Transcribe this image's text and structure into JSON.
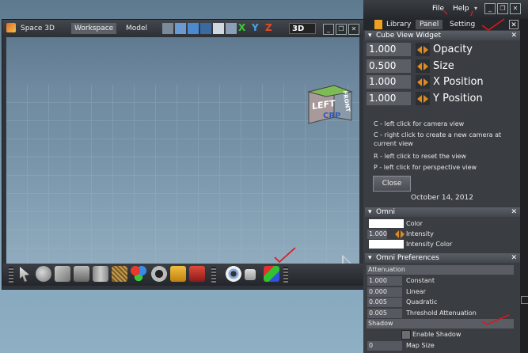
{
  "menubar": {
    "file": "File",
    "help": "Help"
  },
  "window3d": {
    "tabs": [
      "Space 3D",
      "Workspace",
      "Model"
    ],
    "axes": [
      "X",
      "Y",
      "Z"
    ],
    "mode_label": "3D",
    "cube_faces": {
      "left": "LEFT",
      "front": "FRONT"
    },
    "cube_caption": "CRP"
  },
  "panel": {
    "tabs": [
      "Library",
      "Panel",
      "Setting"
    ],
    "cube_widget": {
      "title": "Cube View Widget",
      "fields": [
        {
          "value": "1.000",
          "label": "Opacity"
        },
        {
          "value": "0.500",
          "label": "Size"
        },
        {
          "value": "1.000",
          "label": "X Position"
        },
        {
          "value": "1.000",
          "label": "Y Position"
        }
      ],
      "help": [
        "C - left click for camera view",
        "C - right click to create a new camera at",
        "current view",
        "R - left click to reset the view",
        "P - left click for perspective view"
      ],
      "close_label": "Close",
      "date": "October 14, 2012"
    },
    "omni": {
      "title": "Omni",
      "rows": [
        {
          "value": "",
          "label": "Color"
        },
        {
          "value": "1.000",
          "label": "Intensity"
        },
        {
          "value": "",
          "label": "Intensity  Color"
        }
      ]
    },
    "omni_prefs": {
      "title": "Omni Preferences",
      "attenuation_label": "Attenuation",
      "rows": [
        {
          "value": "1.000",
          "label": "Constant"
        },
        {
          "value": "0.000",
          "label": "Linear"
        },
        {
          "value": "0.005",
          "label": "Quadratic"
        },
        {
          "value": "0.005",
          "label": "Threshold Attenuation"
        }
      ],
      "shadow_label": "Shadow",
      "enable_shadow": "Enable Shadow",
      "map_size_value": "0",
      "map_size_label": "Map Size"
    }
  },
  "colors": {
    "accent_orange": "#e08a1e",
    "annotation_red": "#e0151b"
  }
}
